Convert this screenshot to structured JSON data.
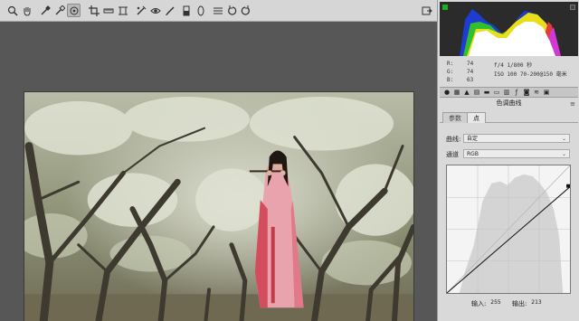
{
  "toolbar": {
    "tools": [
      "zoom-icon",
      "hand-icon",
      "white-balance-icon",
      "color-sampler-icon",
      "targeted-adjustment-icon",
      "crop-icon",
      "straighten-icon",
      "transform-icon",
      "spot-removal-icon",
      "red-eye-icon",
      "adjustment-brush-icon",
      "graduated-filter-icon",
      "radial-filter-icon",
      "preferences-icon",
      "rotate-left-icon",
      "rotate-right-icon"
    ],
    "export_icon": "export-icon"
  },
  "info": {
    "r_label": "R:",
    "r_value": "74",
    "g_label": "G:",
    "g_value": "74",
    "b_label": "B:",
    "b_value": "63",
    "exposure": "f/4  1/800 秒",
    "iso_lens": "ISO 100  70-200@150 毫米"
  },
  "panel": {
    "title": "色调曲线",
    "tabs": [
      "参数",
      "点"
    ],
    "active_tab": "点",
    "curve_label": "曲线:",
    "curve_value": "自定",
    "channel_label": "通道",
    "channel_value": "RGB",
    "input_label": "输入:",
    "input_value": "255",
    "output_label": "输出:",
    "output_value": "213"
  },
  "colors": {
    "toolbar_bg": "#d6d6d6",
    "panel_bg": "#d9d9d9",
    "canvas_bg": "#575757",
    "histogram_bg": "#2b2b2b"
  }
}
